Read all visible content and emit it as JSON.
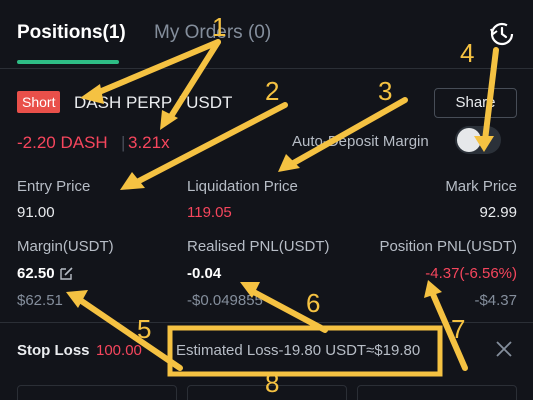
{
  "tabs": [
    {
      "label": "Positions(1)",
      "active": true
    },
    {
      "label": "My Orders (0)",
      "active": false
    }
  ],
  "position": {
    "side_badge": "Short",
    "symbol": "DASH PERP / USDT",
    "size": "-2.20 DASH",
    "leverage": "3.21x",
    "share_label": "Share",
    "auto_deposit_label": "Auto-Deposit Margin",
    "auto_deposit_enabled": false
  },
  "stats": {
    "entry_price_label": "Entry Price",
    "entry_price": "91.00",
    "liquidation_price_label": "Liquidation Price",
    "liquidation_price": "119.05",
    "mark_price_label": "Mark Price",
    "mark_price": "92.99",
    "margin_label": "Margin(USDT)",
    "margin_value": "62.50",
    "margin_usd": "$62.51",
    "realised_pnl_label": "Realised PNL(USDT)",
    "realised_pnl": "-0.04",
    "realised_pnl_usd": "-$0.049855",
    "position_pnl_label": "Position PNL(USDT)",
    "position_pnl": "-4.37(-6.56%)",
    "position_pnl_usd": "-$4.37"
  },
  "stop_loss": {
    "label": "Stop Loss",
    "value": "100.00",
    "estimated_loss": "Estimated Loss-19.80 USDT≈$19.80"
  },
  "annotations": [
    "1",
    "2",
    "3",
    "4",
    "5",
    "6",
    "7",
    "8"
  ],
  "colors": {
    "background": "#12141a",
    "accent_green": "#2ebd85",
    "loss_red": "#f6465d",
    "annotation_yellow": "#f5c242"
  },
  "icons": [
    "history-icon",
    "edit-icon",
    "close-icon"
  ]
}
